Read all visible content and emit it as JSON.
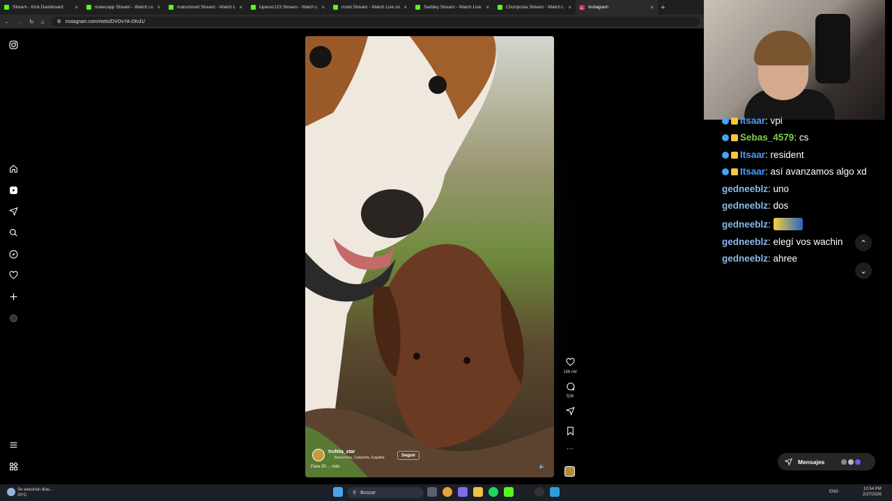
{
  "browser": {
    "tabs": [
      {
        "title": "Stream - Kick Dashboard",
        "active": false
      },
      {
        "title": "matecapp Stream - Watch Live",
        "active": false
      },
      {
        "title": "matumorell Stream - Watch Live",
        "active": false
      },
      {
        "title": "luperez123 Stream - Watch Live",
        "active": false
      },
      {
        "title": "rrosb Stream - Watch Live on K",
        "active": false
      },
      {
        "title": "Saddey Stream - Watch Live on",
        "active": false
      },
      {
        "title": "Choriposta Stream - Watch Live",
        "active": false
      },
      {
        "title": "Instagram",
        "active": true
      }
    ],
    "new_tab_symbol": "+",
    "url": "instagram.com/reels/DVOvYA-DKd1/"
  },
  "instagram": {
    "sidebar_icons": [
      "instagram-logo-icon",
      "home-icon",
      "reels-icon",
      "messages-icon",
      "search-icon",
      "explore-icon",
      "notifications-icon",
      "create-icon",
      "profile-icon",
      "menu-icon",
      "more-apps-icon"
    ],
    "reel": {
      "username": "trufeta_star",
      "location": "Barcelona, Cataluña, España",
      "follow_label": "Seguir",
      "caption": "Fase 20 ... más",
      "likes": "156 mil",
      "comments": "526"
    }
  },
  "chat": {
    "messages": [
      {
        "user": "Itsaar",
        "text": "vpi",
        "color": "#4a9eff",
        "badges": true
      },
      {
        "user": "Sebas_4579",
        "text": "cs",
        "color": "#7fd24a",
        "badges": true
      },
      {
        "user": "Itsaar",
        "text": "resident",
        "color": "#4a9eff",
        "badges": true
      },
      {
        "user": "Itsaar",
        "text": "así avanzamos algo xd",
        "color": "#4a9eff",
        "badges": true
      },
      {
        "user": "gedneeblz",
        "text": "uno",
        "color": "#8bb8e8",
        "badges": false
      },
      {
        "user": "gedneeblz",
        "text": "dos",
        "color": "#8bb8e8",
        "badges": false
      },
      {
        "user": "gedneeblz",
        "text": "",
        "color": "#8bb8e8",
        "badges": false,
        "emote": true
      },
      {
        "user": "gedneeblz",
        "text": "elegí vos wachin",
        "color": "#8bb8e8",
        "badges": false
      },
      {
        "user": "gedneeblz",
        "text": "ahree",
        "color": "#8bb8e8",
        "badges": false
      }
    ],
    "messages_pill_label": "Mensajes"
  },
  "taskbar": {
    "weather_line1": "Se avecinan días...",
    "weather_line2": "20°C",
    "search_label": "Buscar",
    "lang": "ENG",
    "time": "10:54 PM",
    "date": "2/27/2026"
  }
}
